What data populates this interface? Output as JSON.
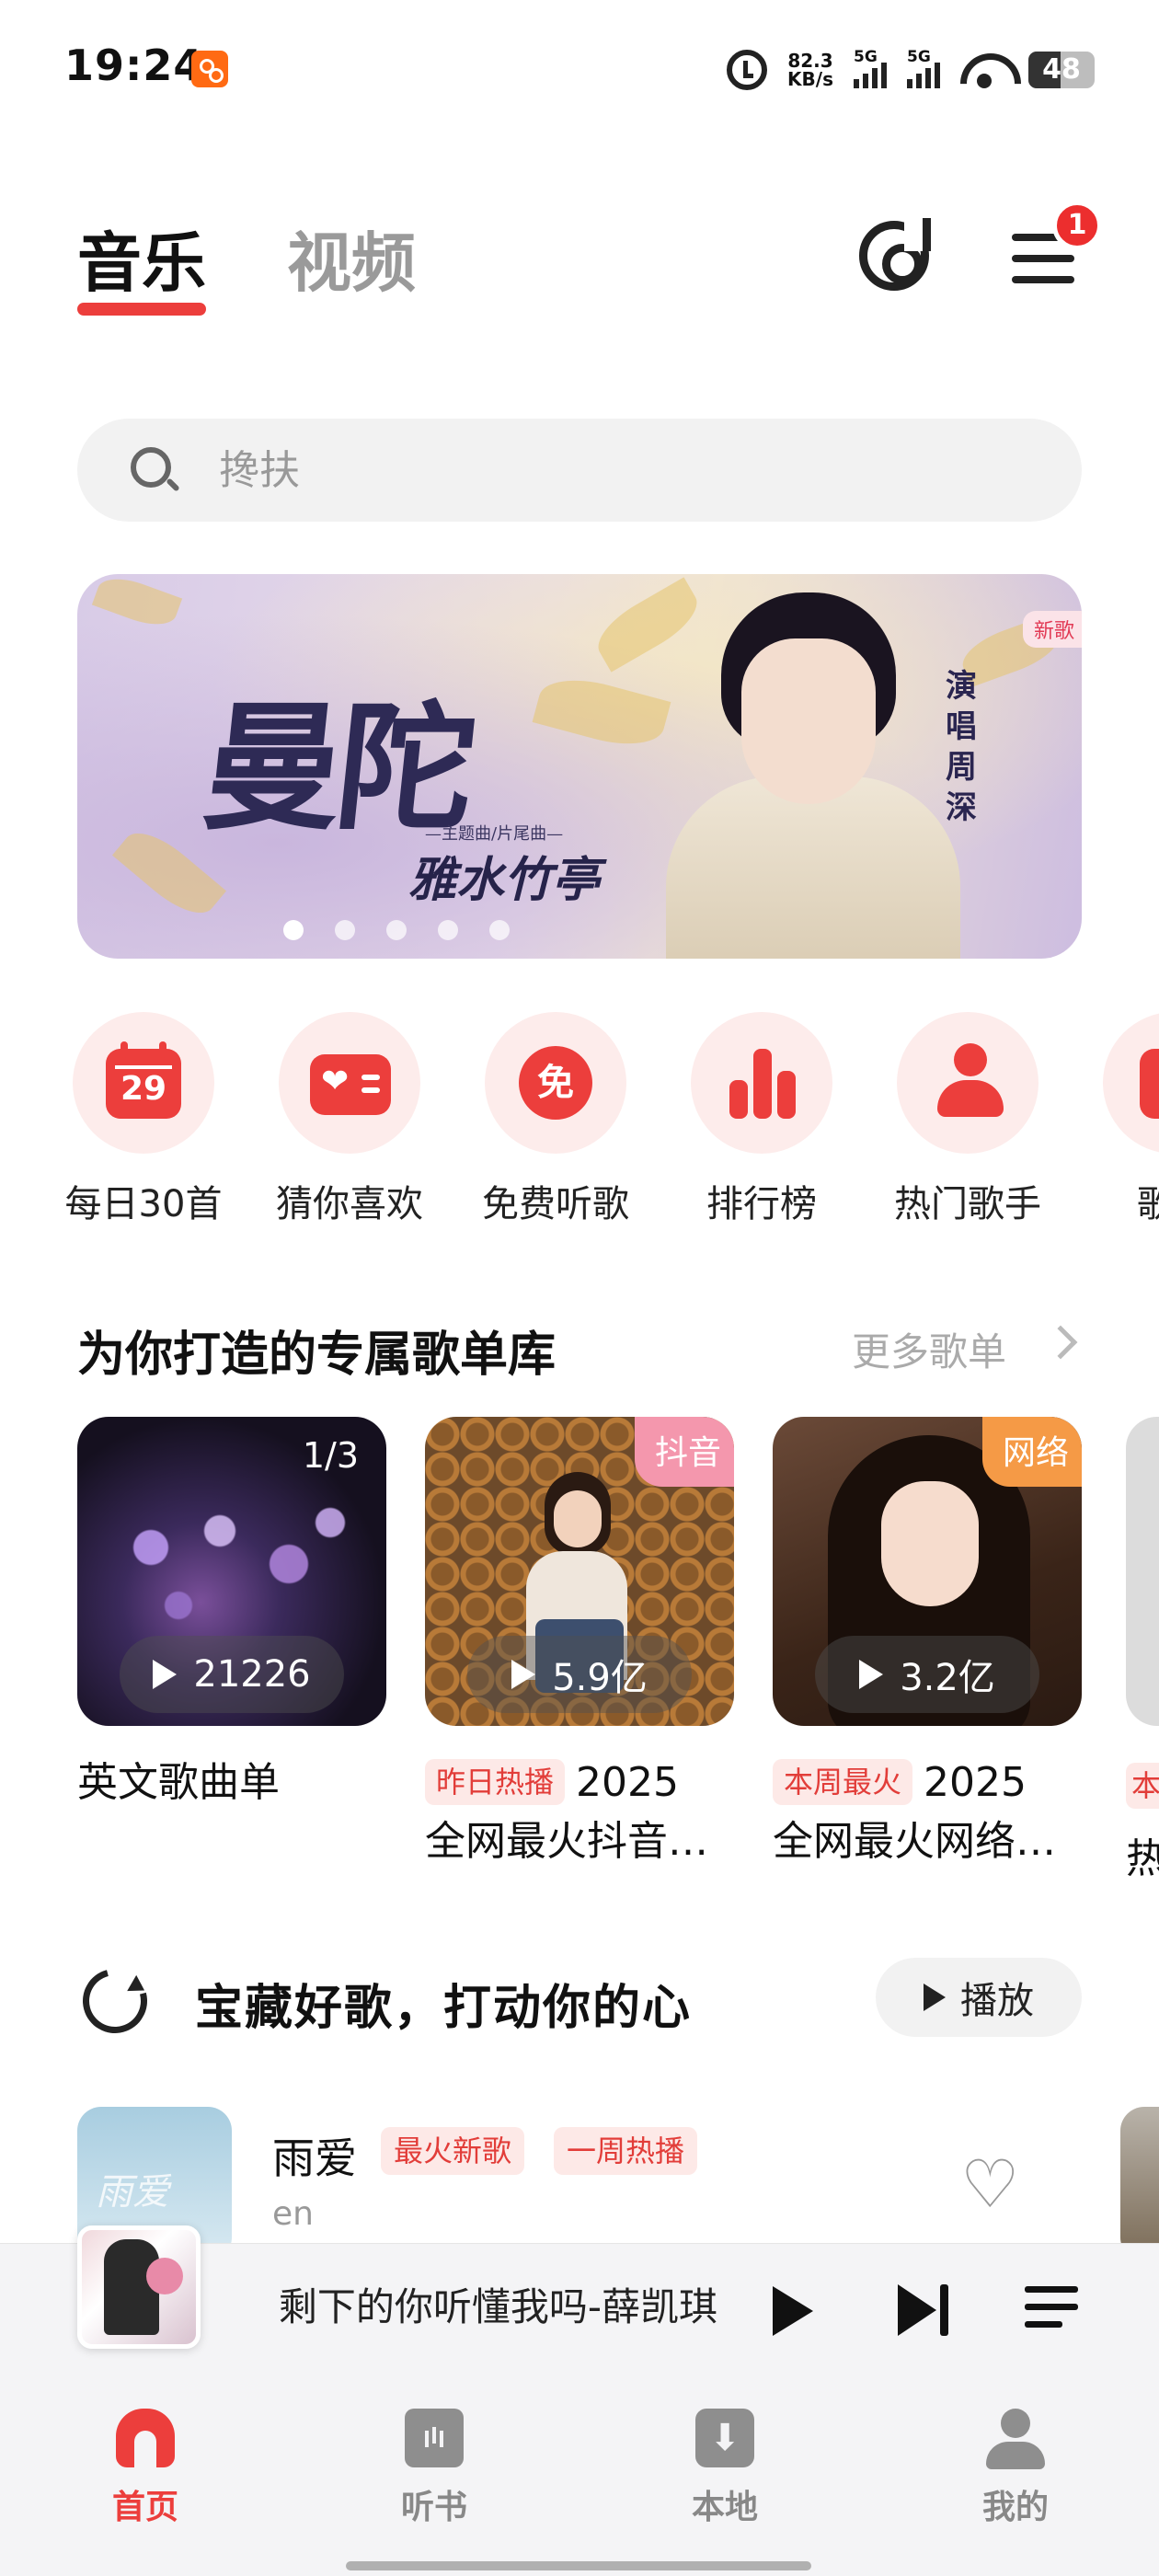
{
  "status_bar": {
    "time": "19:24",
    "net_speed_value": "82.3",
    "net_speed_unit": "KB/s",
    "sim1": "5G",
    "sim2": "5G",
    "battery": "48",
    "battery_level": 0.48
  },
  "header": {
    "tabs": [
      {
        "label": "音乐",
        "active": true
      },
      {
        "label": "视频",
        "active": false
      }
    ],
    "menu_badge": "1"
  },
  "search": {
    "placeholder": "搀扶"
  },
  "banner": {
    "title": "曼陀",
    "small_caption": "—主题曲/片尾曲—",
    "subtitle": "雅水竹亭",
    "singer_text": "演唱周深",
    "tag": "新歌",
    "dots_count": 5,
    "active_dot": 1
  },
  "quick_actions": [
    {
      "label": "每日30首",
      "icon": "calendar-icon",
      "day": "29"
    },
    {
      "label": "猜你喜欢",
      "icon": "heart-radio-icon"
    },
    {
      "label": "免费听歌",
      "icon": "free-badge-icon",
      "glyph": "免"
    },
    {
      "label": "排行榜",
      "icon": "bar-chart-icon"
    },
    {
      "label": "热门歌手",
      "icon": "singer-icon"
    },
    {
      "label": "歌单",
      "icon": "playlist-icon"
    }
  ],
  "playlists_section": {
    "title": "为你打造的专属歌单库",
    "more": "更多歌单",
    "items": [
      {
        "name": "英文歌曲单",
        "plays": "21226",
        "page_indicator": "1/3",
        "chip": "",
        "corner_tag": ""
      },
      {
        "name_line1": "2025",
        "name_line2": "全网最火抖音…",
        "plays": "5.9亿",
        "chip": "昨日热播",
        "corner_tag": "抖音"
      },
      {
        "name_line1": "2025",
        "name_line2": "全网最火网络…",
        "plays": "3.2亿",
        "chip": "本周最火",
        "corner_tag": "网络"
      }
    ],
    "partial_chip": "本",
    "partial_text": "热"
  },
  "treasure_section": {
    "title": "宝藏好歌，打动你的心",
    "play_label": "播放",
    "songs": [
      {
        "title": "雨爱",
        "artist": "en",
        "tags": [
          "最火新歌",
          "一周热播"
        ]
      }
    ]
  },
  "mini_player": {
    "title": "剩下的你听懂我吗-薛凯琪"
  },
  "bottom_nav": [
    {
      "label": "首页",
      "active": true
    },
    {
      "label": "听书",
      "active": false
    },
    {
      "label": "本地",
      "active": false
    },
    {
      "label": "我的",
      "active": false
    }
  ],
  "colors": {
    "accent": "#ec3e3c",
    "tag_bg": "#fde9e7"
  }
}
